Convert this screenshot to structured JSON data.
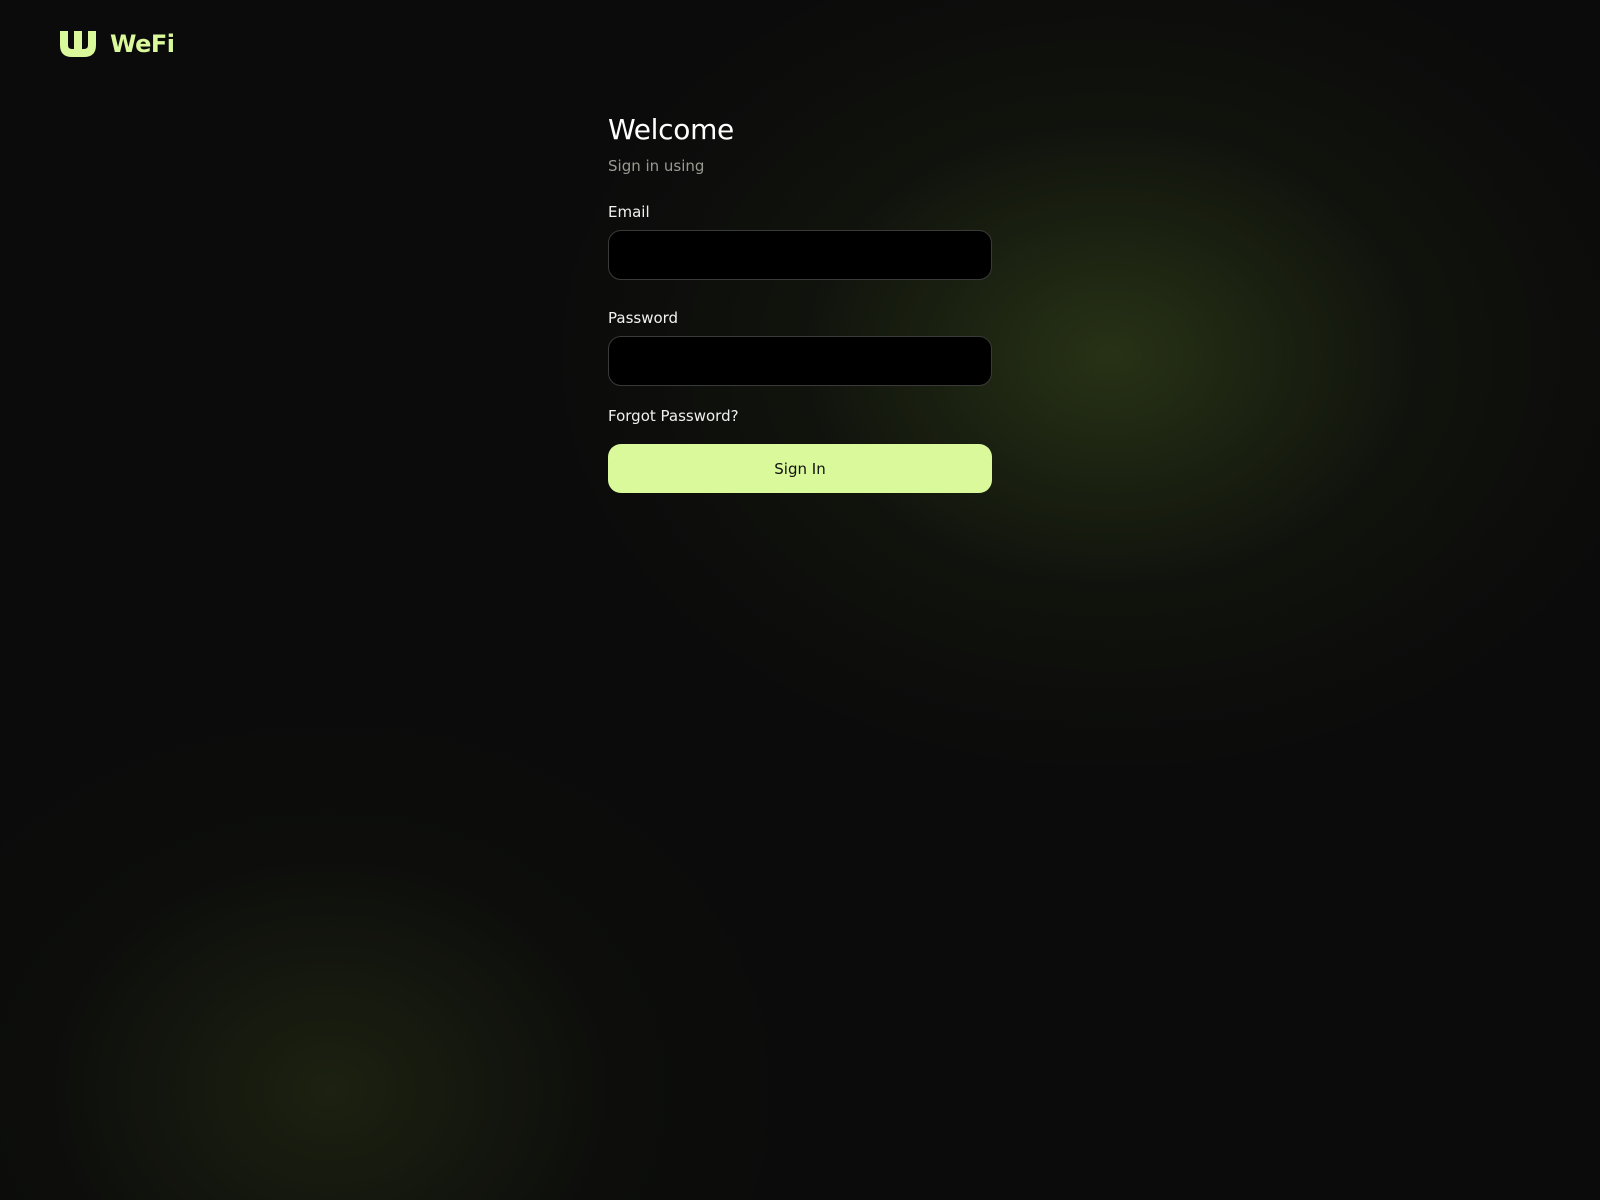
{
  "brand": {
    "name": "WeFi",
    "logo_icon": "wefi-logo-icon",
    "accent_color": "#d9f99a"
  },
  "login": {
    "title": "Welcome",
    "subtitle": "Sign in using",
    "email_label": "Email",
    "email_value": "",
    "email_placeholder": "",
    "password_label": "Password",
    "password_value": "",
    "password_placeholder": "",
    "forgot_label": "Forgot Password?",
    "submit_label": "Sign In"
  },
  "colors": {
    "background": "#0b0b0b",
    "input_background": "#000000",
    "button_background": "#d9f99a",
    "button_text": "#111111",
    "subtitle_text": "#9a9a92"
  }
}
